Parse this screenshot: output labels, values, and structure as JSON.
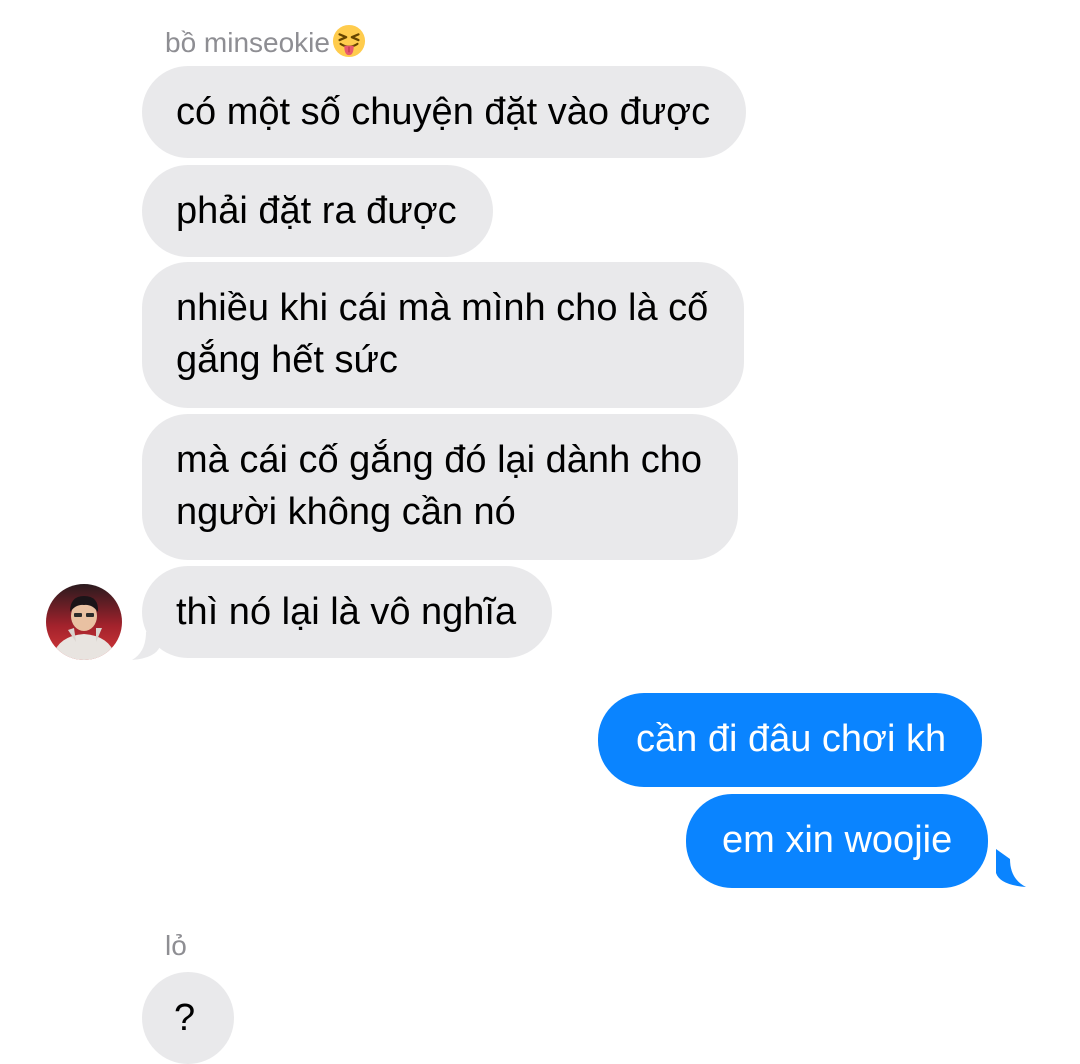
{
  "thread": {
    "sender1_name": "bồ minseokie",
    "sender1_emoji": "squinting-face-with-tongue",
    "incoming_1": [
      "có một số chuyện đặt vào được",
      "phải đặt ra được",
      "nhiều khi cái mà mình cho là cố",
      "gắng hết sức",
      "mà cái cố gắng đó lại dành cho",
      "người không cần nó",
      "thì nó lại là vô nghĩa"
    ],
    "outgoing": [
      "cần đi đâu chơi kh",
      "em xin woojie"
    ],
    "sender2_name": "lỏ",
    "incoming_2": [
      "?"
    ]
  },
  "colors": {
    "incoming_bubble": "#e9e9eb",
    "outgoing_bubble": "#0a84ff",
    "sender_name": "#8e8e93"
  }
}
